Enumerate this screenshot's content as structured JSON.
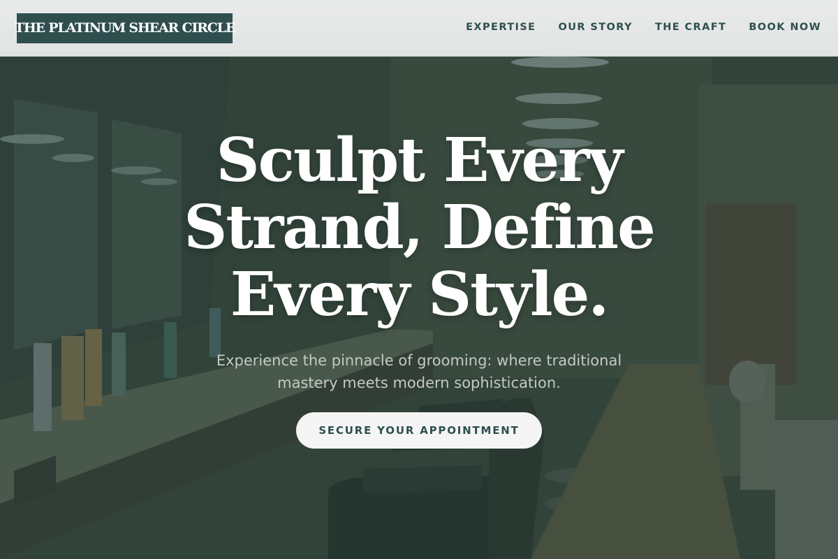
{
  "header": {
    "brand": "THE PLATINUM SHEAR CIRCLE",
    "nav": [
      {
        "label": "EXPERTISE"
      },
      {
        "label": "OUR STORY"
      },
      {
        "label": "THE CRAFT"
      },
      {
        "label": "BOOK NOW"
      }
    ]
  },
  "hero": {
    "headline": "Sculpt Every Strand, Define Every Style.",
    "subheadline": "Experience the pinnacle of grooming: where traditional mastery meets modern sophistication.",
    "cta_label": "SECURE YOUR APPOINTMENT",
    "background_image": "barbershop-interior-photo"
  },
  "colors": {
    "brand": "#2f4f4f",
    "header_bg": "#e6e7e7",
    "cta_bg": "#f4f5f4",
    "overlay": "#2a4038"
  }
}
